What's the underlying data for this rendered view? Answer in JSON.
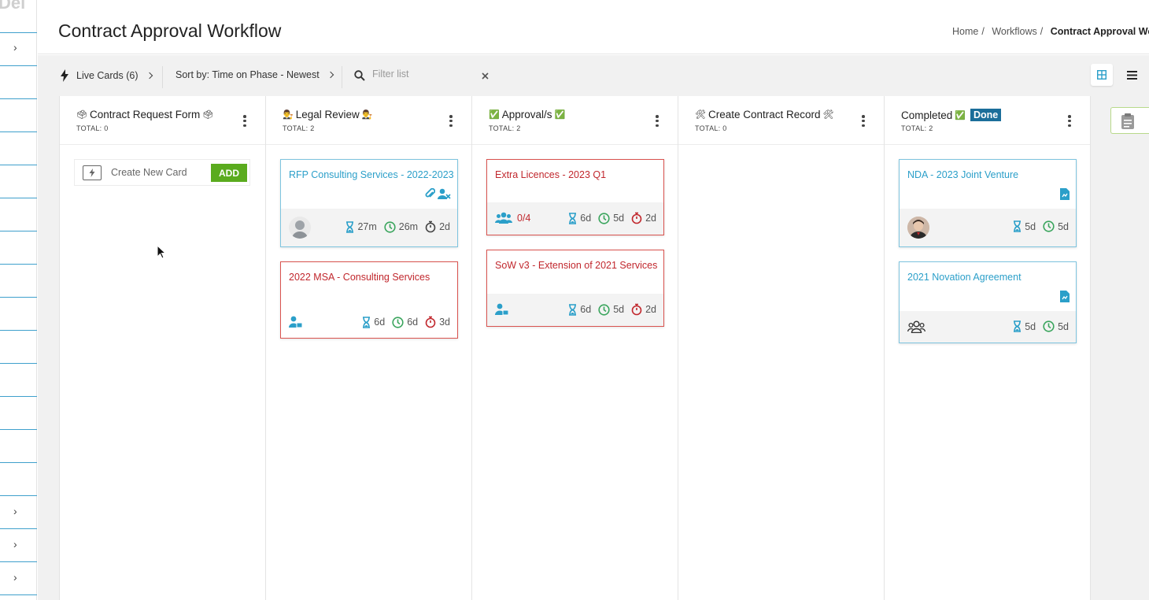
{
  "rail": {
    "logo_text": "Del"
  },
  "header": {
    "title": "Contract Approval Workflow",
    "breadcrumb": [
      "Home",
      "Workflows",
      "Contract Approval Workflow"
    ]
  },
  "toolbar": {
    "live_cards": "Live Cards (6)",
    "sort": "Sort by: Time on Phase - Newest",
    "filter_placeholder": "Filter list"
  },
  "columns": [
    {
      "title": "Contract Request Form",
      "emoji": "🗳",
      "total": "TOTAL: 0"
    },
    {
      "title": "Legal Review",
      "emoji": "👨‍⚖️",
      "total": "TOTAL: 2"
    },
    {
      "title": "Approval/s",
      "emoji": "✅",
      "total": "TOTAL: 2"
    },
    {
      "title": "Create Contract Record",
      "emoji": "🛠",
      "total": "TOTAL: 0"
    },
    {
      "title": "Completed",
      "emoji": "✅",
      "badge": "Done",
      "total": "TOTAL: 2"
    }
  ],
  "new_card": {
    "placeholder": "Create New Card",
    "add_label": "ADD"
  },
  "cards": {
    "rfp": {
      "title": "RFP Consulting Services - 2022-2023",
      "hourglass": "27m",
      "clock": "26m",
      "timer": "2d"
    },
    "msa": {
      "title": "2022 MSA - Consulting Services",
      "hourglass": "6d",
      "clock": "6d",
      "timer": "3d"
    },
    "licences": {
      "title": "Extra Licences - 2023 Q1",
      "approvers": "0/4",
      "hourglass": "6d",
      "clock": "5d",
      "timer": "2d"
    },
    "sow": {
      "title": "SoW v3 - Extension of 2021 Services",
      "hourglass": "6d",
      "clock": "5d",
      "timer": "2d"
    },
    "nda": {
      "title": "NDA - 2023 Joint Venture",
      "hourglass": "5d",
      "clock": "5d"
    },
    "novation": {
      "title": "2021 Novation Agreement",
      "hourglass": "5d",
      "clock": "5d"
    }
  },
  "colors": {
    "accent": "#2b9fc9",
    "red": "#c1272d",
    "green": "#5aab1e",
    "done": "#1b6e9a"
  }
}
